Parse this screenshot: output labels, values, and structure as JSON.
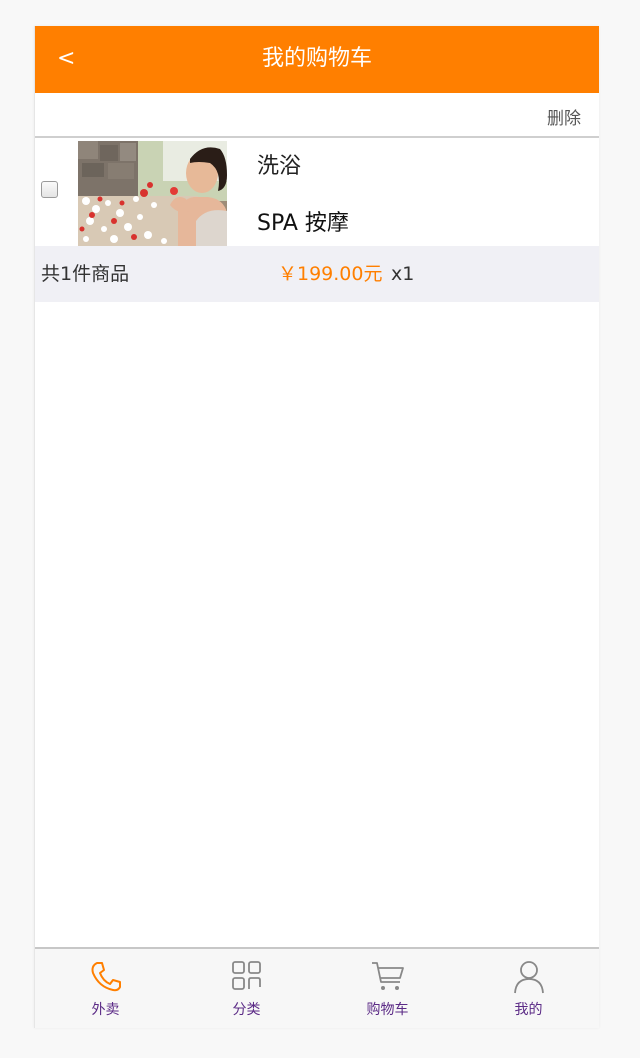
{
  "header": {
    "back_label": "<",
    "title": "我的购物车"
  },
  "toolbar": {
    "delete_label": "删除"
  },
  "cart": {
    "items": [
      {
        "name": "洗浴",
        "subtitle": "SPA 按摩",
        "checked": false
      }
    ],
    "summary": {
      "count_text": "共1件商品",
      "price": "￥199.00元",
      "quantity": "x1"
    }
  },
  "tabbar": {
    "tabs": [
      {
        "label": "外卖",
        "icon": "phone-icon",
        "active": true
      },
      {
        "label": "分类",
        "icon": "grid-icon",
        "active": false
      },
      {
        "label": "购物车",
        "icon": "cart-icon",
        "active": false
      },
      {
        "label": "我的",
        "icon": "user-icon",
        "active": false
      }
    ]
  },
  "colors": {
    "accent": "#ff7f00",
    "tab_label": "#5b2a86",
    "summary_bg": "#f0f0f5"
  }
}
